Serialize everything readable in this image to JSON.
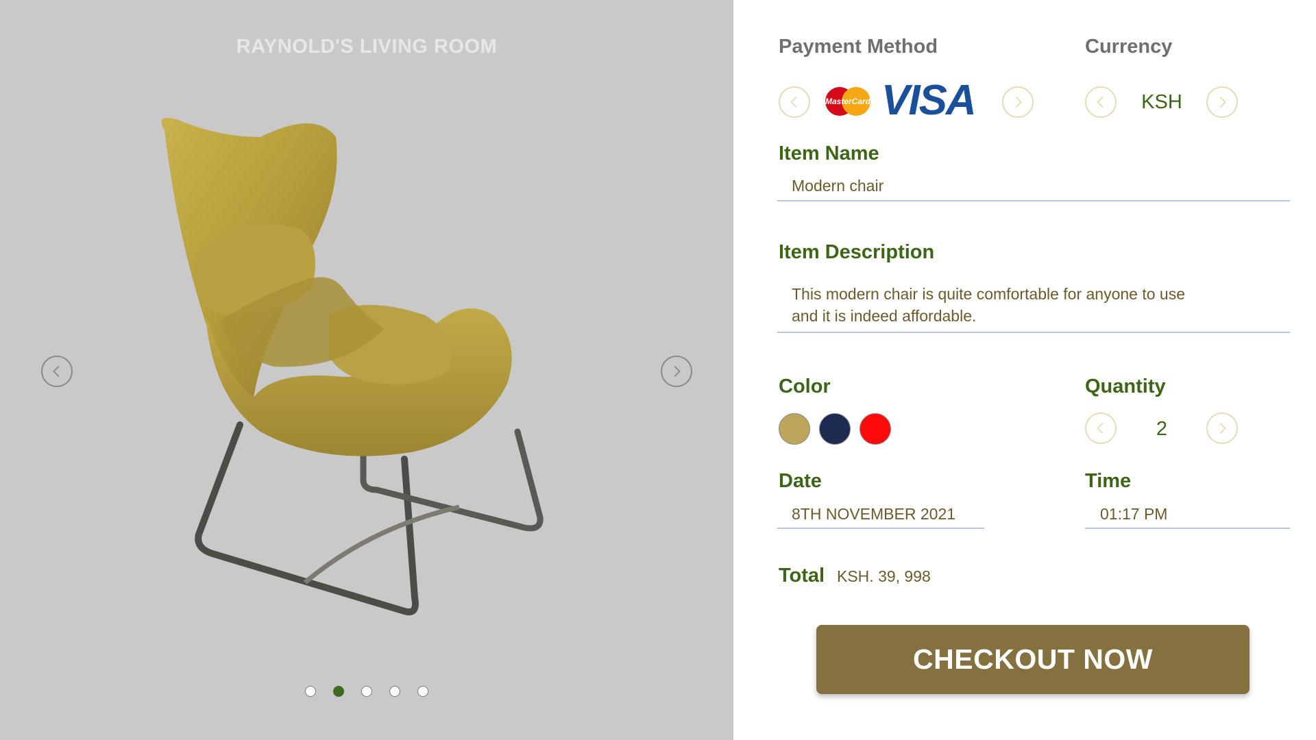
{
  "room": {
    "title": "RAYNOLD'S LIVING ROOM",
    "carousel_dots": 5,
    "active_dot": 2
  },
  "payment": {
    "heading": "Payment Method",
    "cards": [
      "MasterCard",
      "VISA"
    ],
    "visa_label": "VISA",
    "mastercard_label": "MasterCard"
  },
  "currency": {
    "heading": "Currency",
    "value": "KSH"
  },
  "item": {
    "name_heading": "Item Name",
    "name": "Modern chair",
    "description_heading": "Item Description",
    "description_line1": "This modern chair is quite comfortable for anyone to use",
    "description_line2": "and it is indeed affordable."
  },
  "color": {
    "heading": "Color",
    "options": [
      "#bda65b",
      "#1e2a4f",
      "#ff0a0a"
    ]
  },
  "quantity": {
    "heading": "Quantity",
    "value": "2"
  },
  "date": {
    "heading": "Date",
    "value": "8TH NOVEMBER 2021"
  },
  "time": {
    "heading": "Time",
    "value": "01:17 PM"
  },
  "total": {
    "label": "Total",
    "value": "KSH. 39, 998"
  },
  "checkout": {
    "label": "CHECKOUT NOW"
  },
  "colors": {
    "accent_green": "#3d6516",
    "button_gold": "#857140",
    "panel_gray": "#c9c9c9"
  }
}
